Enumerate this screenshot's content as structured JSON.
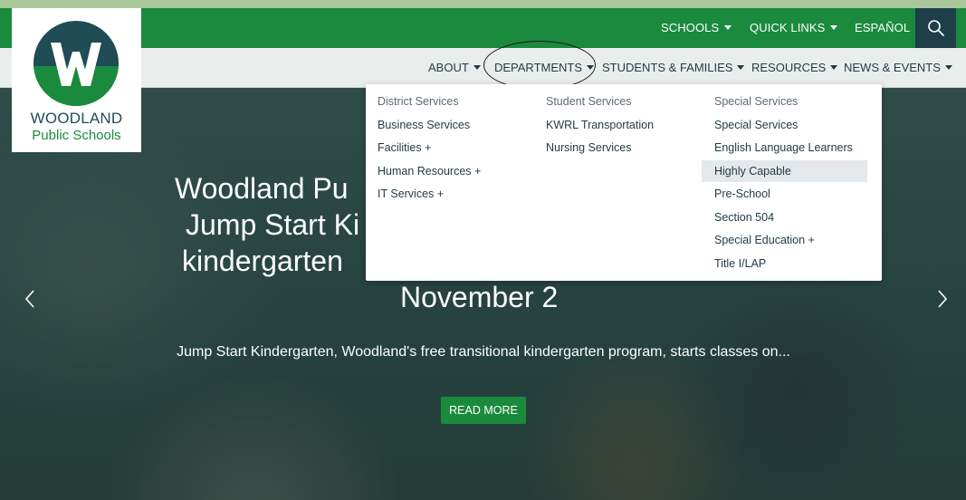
{
  "utility": {
    "schools": "SCHOOLS",
    "quick_links": "QUICK LINKS",
    "espanol": "ESPAÑOL"
  },
  "logo": {
    "name": "WOODLAND",
    "sub": "Public Schools"
  },
  "nav": {
    "about": "ABOUT",
    "departments": "DEPARTMENTS",
    "students": "STUDENTS & FAMILIES",
    "resources": "RESOURCES",
    "news": "NEWS & EVENTS"
  },
  "dropdown": {
    "col1": [
      "District Services",
      "Business Services",
      "Facilities +",
      "Human Resources +",
      "IT Services +"
    ],
    "col2": [
      "Student Services",
      "KWRL Transportation",
      "Nursing Services"
    ],
    "col3": [
      "Special Services",
      "Special Services",
      "English Language Learners",
      "Highly Capable",
      "Pre-School",
      "Section 504",
      "Special Education +",
      "Title I/LAP"
    ]
  },
  "hero": {
    "line1": "Woodland Pu",
    "line2": "Jump Start Ki",
    "line3": "kindergarten",
    "line4": "November 2",
    "description": "Jump Start Kindergarten, Woodland's free transitional kindergarten program, starts classes on...",
    "button": "READ MORE"
  },
  "colors": {
    "brand_green": "#1a8a3d",
    "brand_navy": "#1f4c55",
    "highlight": "#e5e8ea"
  }
}
